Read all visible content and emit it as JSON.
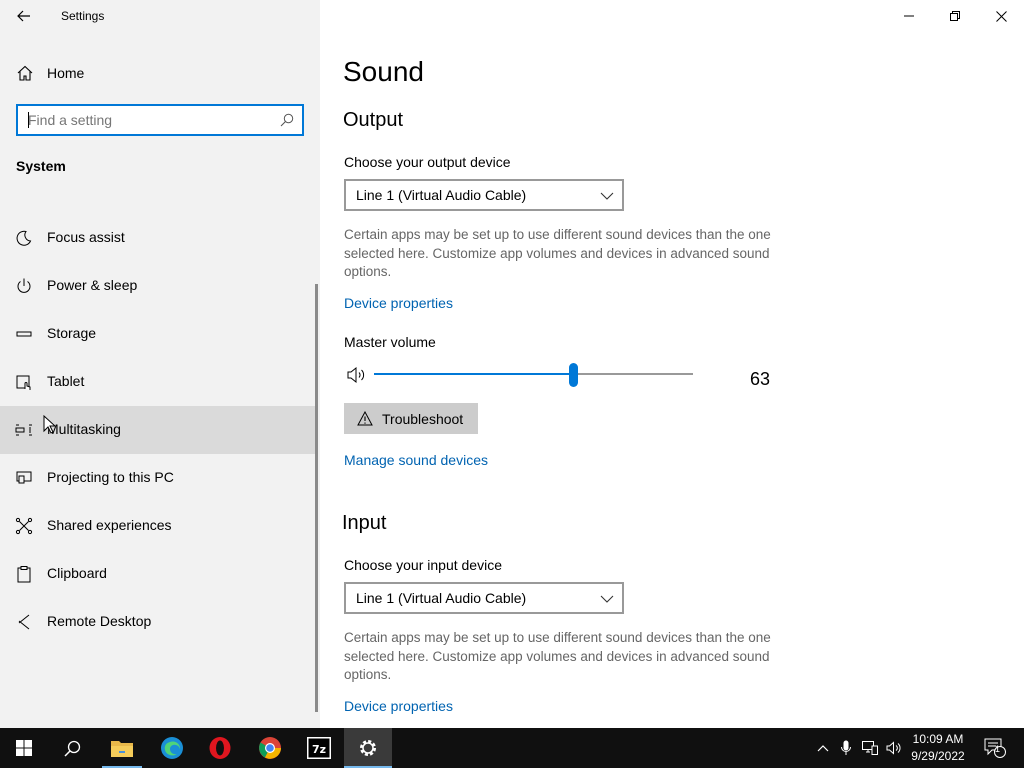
{
  "app": {
    "title": "Settings"
  },
  "sidebar": {
    "home_label": "Home",
    "search_placeholder": "Find a setting",
    "section_title": "System",
    "items": [
      {
        "label": "Focus assist",
        "icon": "moon-icon"
      },
      {
        "label": "Power & sleep",
        "icon": "power-icon"
      },
      {
        "label": "Storage",
        "icon": "storage-icon"
      },
      {
        "label": "Tablet",
        "icon": "tablet-icon"
      },
      {
        "label": "Multitasking",
        "icon": "multitasking-icon"
      },
      {
        "label": "Projecting to this PC",
        "icon": "projecting-icon"
      },
      {
        "label": "Shared experiences",
        "icon": "shared-experiences-icon"
      },
      {
        "label": "Clipboard",
        "icon": "clipboard-icon"
      },
      {
        "label": "Remote Desktop",
        "icon": "remote-desktop-icon"
      }
    ]
  },
  "main": {
    "title": "Sound",
    "output": {
      "heading": "Output",
      "choose_label": "Choose your output device",
      "device": "Line 1 (Virtual Audio Cable)",
      "description": "Certain apps may be set up to use different sound devices than the one selected here. Customize app volumes and devices in advanced sound options.",
      "device_properties": "Device properties",
      "master_volume_label": "Master volume",
      "volume_value": "63",
      "troubleshoot": "Troubleshoot",
      "manage_devices": "Manage sound devices"
    },
    "input": {
      "heading": "Input",
      "choose_label": "Choose your input device",
      "device": "Line 1 (Virtual Audio Cable)",
      "description": "Certain apps may be set up to use different sound devices than the one selected here. Customize app volumes and devices in advanced sound options.",
      "device_properties": "Device properties"
    }
  },
  "taskbar": {
    "apps": [
      "start",
      "search",
      "file-explorer",
      "edge",
      "opera",
      "chrome",
      "7-zip",
      "settings"
    ],
    "clock_time": "10:09 AM",
    "clock_date": "9/29/2022",
    "notification_count": "1"
  },
  "colors": {
    "accent": "#0078d7",
    "link": "#0063b1",
    "sidebar_bg": "#f2f2f2",
    "taskbar_bg": "#101010"
  }
}
